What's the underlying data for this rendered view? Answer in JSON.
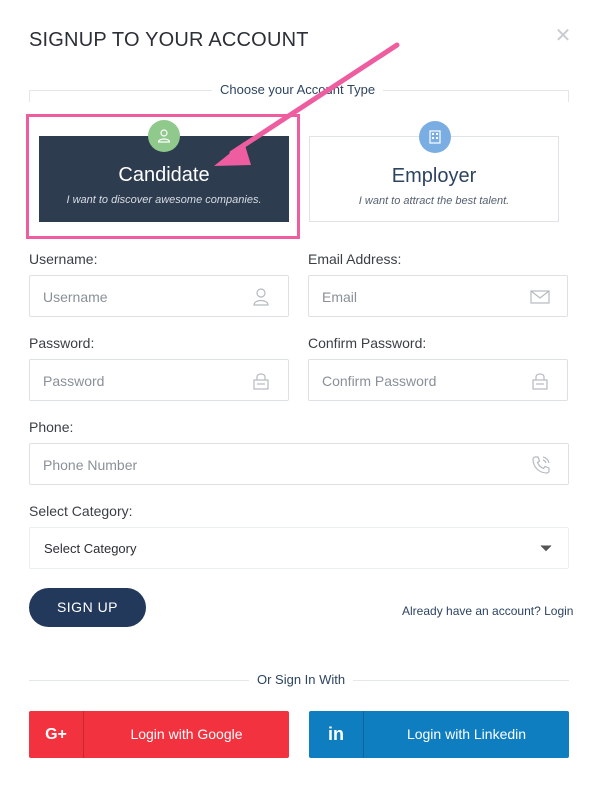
{
  "modal": {
    "title": "SIGNUP TO YOUR ACCOUNT",
    "close_icon": "close-icon"
  },
  "account_type": {
    "legend": "Choose your Account Type",
    "options": [
      {
        "title": "Candidate",
        "subtitle": "I want to discover awesome companies.",
        "icon": "user-icon",
        "selected": true
      },
      {
        "title": "Employer",
        "subtitle": "I want to attract the best talent.",
        "icon": "building-icon",
        "selected": false
      }
    ]
  },
  "form": {
    "username": {
      "label": "Username:",
      "placeholder": "Username",
      "icon": "user-icon"
    },
    "email": {
      "label": "Email Address:",
      "placeholder": "Email",
      "icon": "envelope-icon"
    },
    "password": {
      "label": "Password:",
      "placeholder": "Password",
      "icon": "lock-icon"
    },
    "confirm_password": {
      "label": "Confirm Password:",
      "placeholder": "Confirm Password",
      "icon": "lock-icon"
    },
    "phone": {
      "label": "Phone:",
      "placeholder": "Phone Number",
      "icon": "phone-icon"
    },
    "category": {
      "label": "Select Category:",
      "value": "Select Category",
      "icon": "chevron-down-icon"
    }
  },
  "actions": {
    "signup": "SIGN UP",
    "login_link": "Already have an account? Login"
  },
  "social": {
    "divider": "Or Sign In With",
    "google": {
      "label": "Login with Google",
      "icon_text": "G+"
    },
    "linkedin": {
      "label": "Login with Linkedin",
      "icon_text": "in"
    }
  },
  "colors": {
    "candidate_bg": "#2e3c4f",
    "highlight": "#ee5da0",
    "primary": "#23395b",
    "google": "#f2323e",
    "linkedin": "#0f7ec1"
  }
}
